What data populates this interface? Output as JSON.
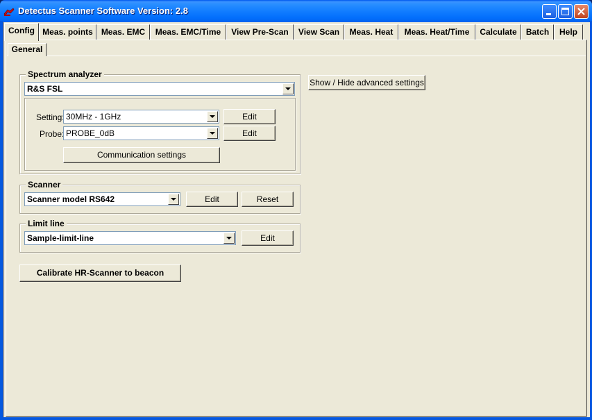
{
  "window": {
    "title": "Detectus Scanner Software Version: 2.8",
    "controls": {
      "minimize": "minimize",
      "maximize": "maximize",
      "close": "close"
    }
  },
  "tabs": [
    {
      "label": "Config",
      "active": true
    },
    {
      "label": "Meas. points"
    },
    {
      "label": "Meas. EMC"
    },
    {
      "label": "Meas. EMC/Time"
    },
    {
      "label": "View Pre-Scan"
    },
    {
      "label": "View Scan"
    },
    {
      "label": "Meas. Heat"
    },
    {
      "label": "Meas. Heat/Time"
    },
    {
      "label": "Calculate"
    },
    {
      "label": "Batch"
    },
    {
      "label": "Help"
    }
  ],
  "subtabs": [
    {
      "label": "General",
      "active": true
    }
  ],
  "spectrum_analyzer": {
    "group_label": "Spectrum analyzer",
    "selected": "R&S FSL",
    "setting_label": "Setting:",
    "setting_value": "30MHz - 1GHz",
    "setting_edit": "Edit",
    "probe_label": "Probe:",
    "probe_value": "PROBE_0dB",
    "probe_edit": "Edit",
    "communication_button": "Communication settings"
  },
  "advanced_button": "Show / Hide advanced settings",
  "scanner": {
    "group_label": "Scanner",
    "selected": "Scanner model RS642",
    "edit": "Edit",
    "reset": "Reset"
  },
  "limit_line": {
    "group_label": "Limit line",
    "selected": "Sample-limit-line",
    "edit": "Edit"
  },
  "calibrate_button": "Calibrate HR-Scanner to beacon",
  "icons": {
    "app": "red-scanner-icon",
    "dropdown": "chevron-down-icon"
  },
  "colors": {
    "titlebar": "#0262EE",
    "face": "#ECE9D8",
    "close": "#C1441F"
  }
}
